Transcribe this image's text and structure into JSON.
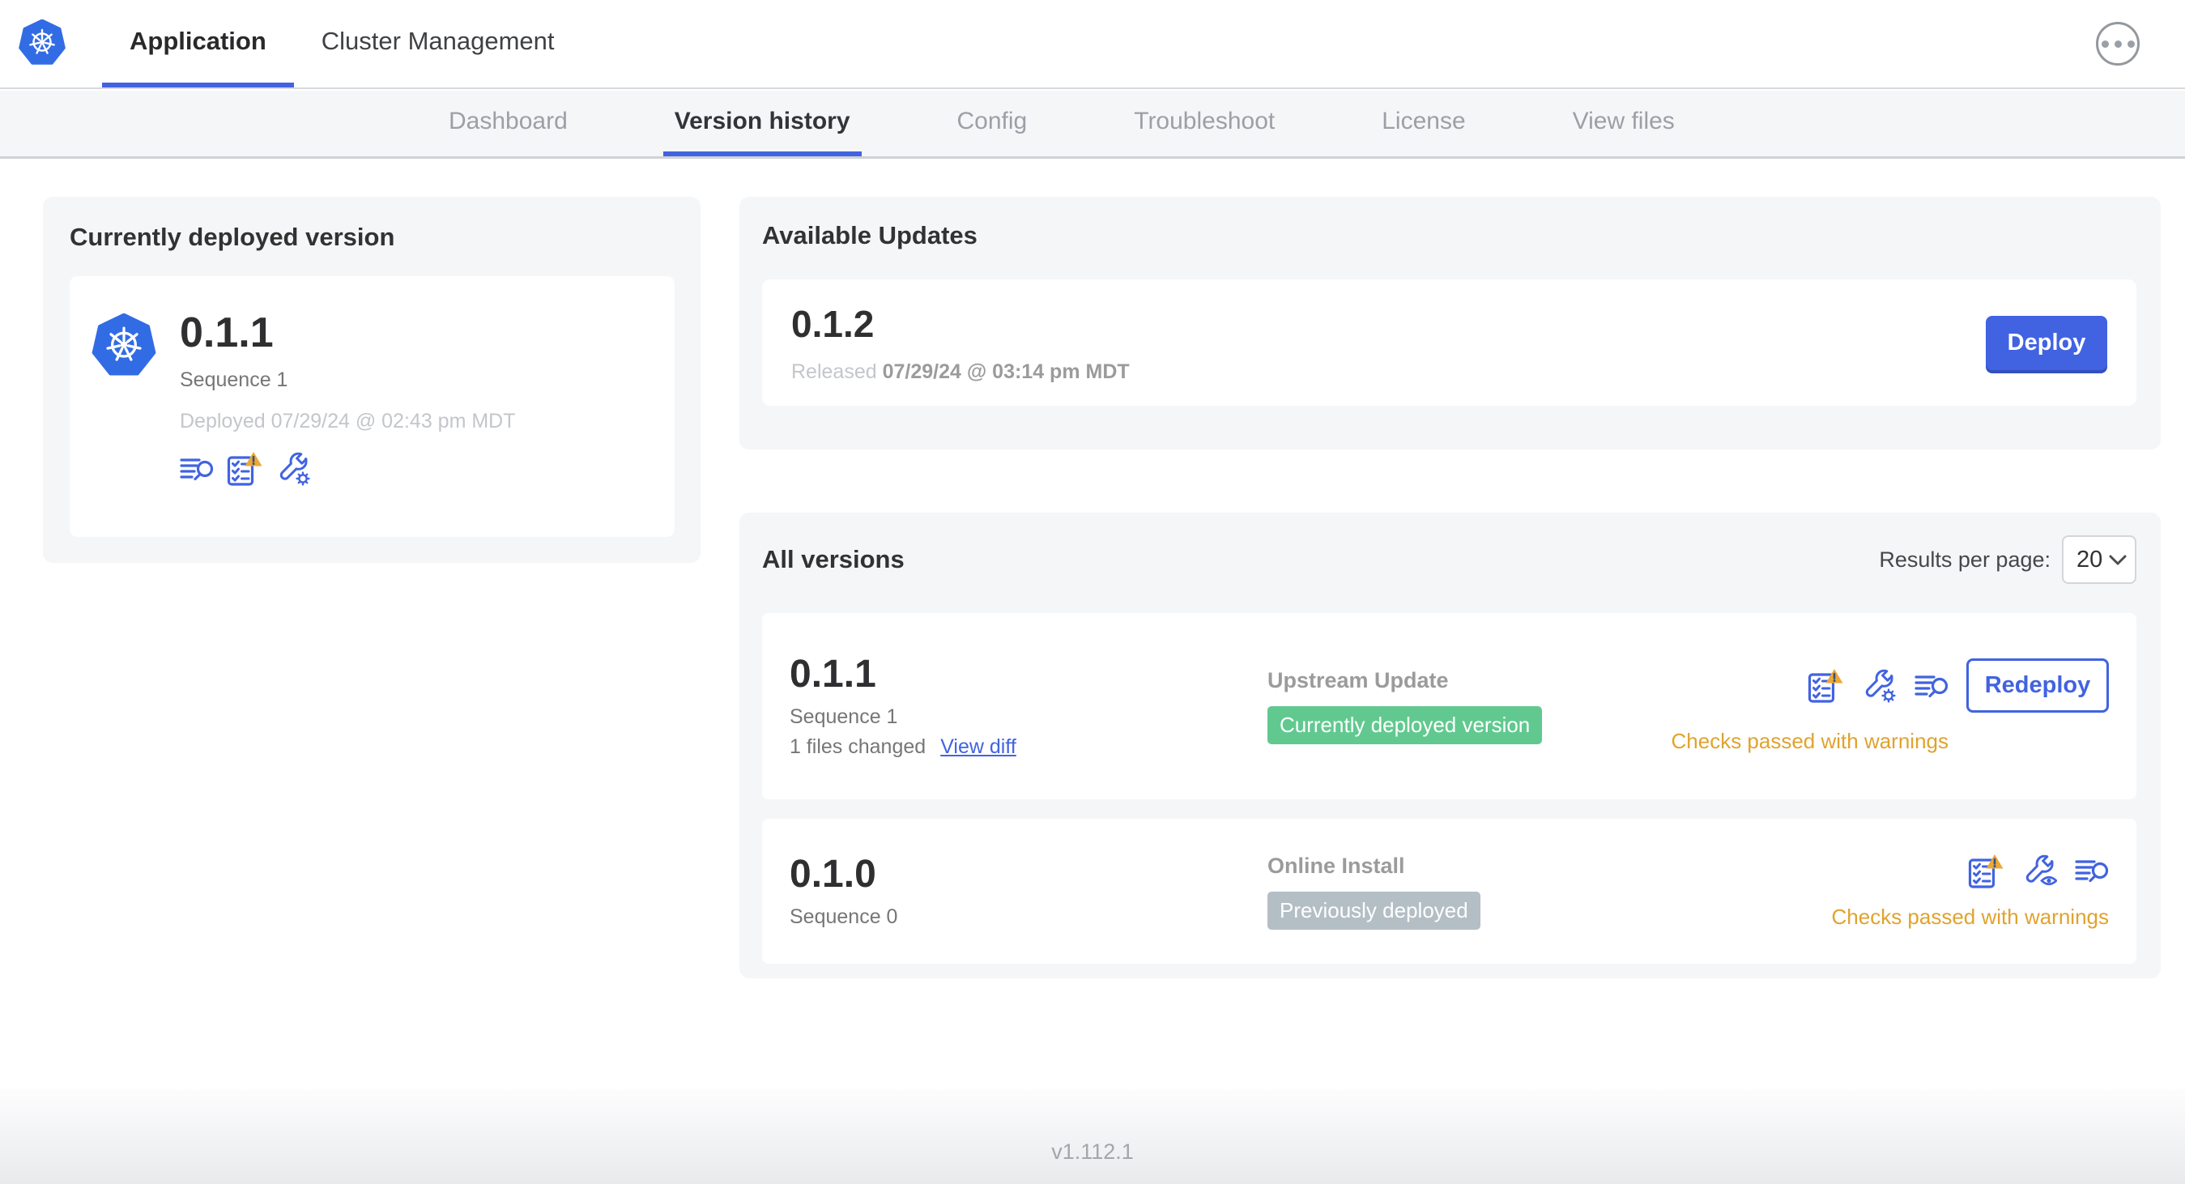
{
  "colors": {
    "accent_blue": "#4163e1",
    "k8s_blue": "#326ce5",
    "warning_amber": "#e0a32e",
    "badge_green": "#61c98f",
    "badge_gray": "#b4bec5"
  },
  "icons": {
    "brand": "kubernetes-logo",
    "top_right": "ellipsis-menu-icon",
    "logs": "log-search-icon",
    "preflight": "preflight-checklist-warning-icon",
    "edit_config": "wrench-gear-icon",
    "view_config": "wrench-eye-icon",
    "select_arrow": "chevron-down-icon"
  },
  "topbar": {
    "tabs": [
      {
        "label": "Application"
      },
      {
        "label": "Cluster Management"
      }
    ]
  },
  "subnav": {
    "tabs": [
      "Dashboard",
      "Version history",
      "Config",
      "Troubleshoot",
      "License",
      "View files"
    ],
    "active": "Version history"
  },
  "current_card": {
    "title": "Currently deployed version",
    "version": "0.1.1",
    "sequence": "Sequence 1",
    "deployed": "Deployed 07/29/24 @ 02:43 pm MDT"
  },
  "available_updates": {
    "title": "Available Updates",
    "version": "0.1.2",
    "released_prefix": "Released ",
    "released_date": "07/29/24 @ 03:14 pm MDT",
    "deploy_label": "Deploy"
  },
  "all_versions": {
    "title": "All versions",
    "results_per_page_label": "Results per page:",
    "results_per_page_value": "20",
    "rows": [
      {
        "version": "0.1.1",
        "sequence": "Sequence 1",
        "files_changed": "1 files changed",
        "view_diff_label": "View diff",
        "source": "Upstream Update",
        "badge_label": "Currently deployed version",
        "badge_bg": "#61c98f",
        "action_label": "Redeploy",
        "checks_text": "Checks passed with warnings"
      },
      {
        "version": "0.1.0",
        "sequence": "Sequence 0",
        "source": "Online Install",
        "badge_label": "Previously deployed",
        "badge_bg": "#b4bec5",
        "checks_text": "Checks passed with warnings"
      }
    ]
  },
  "footer": {
    "version": "v1.112.1"
  }
}
